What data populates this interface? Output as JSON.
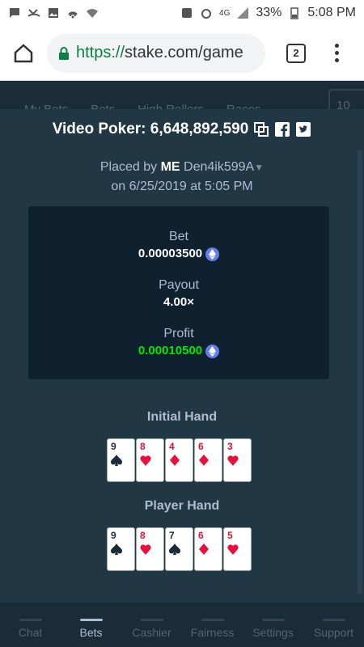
{
  "statusbar": {
    "battery": "33%",
    "time": "5:08 PM",
    "network": "4G"
  },
  "browser": {
    "url_scheme": "https://",
    "url_rest": "stake.com/game",
    "tab_count": "2"
  },
  "bg_tabs": [
    "My Bets",
    "Bets",
    "High Rollers",
    "Races"
  ],
  "bg_select": "10",
  "modal": {
    "title": "Video Poker: 6,648,892,590",
    "placed_prefix": "Placed by",
    "placed_me": "ME",
    "username": "Den4ik599A",
    "date_line": "on 6/25/2019 at 5:05 PM"
  },
  "stats": {
    "bet_label": "Bet",
    "bet_value": "0.00003500",
    "payout_label": "Payout",
    "payout_value": "4.00×",
    "profit_label": "Profit",
    "profit_value": "0.00010500"
  },
  "initial_hand": {
    "label": "Initial Hand",
    "cards": [
      {
        "rank": "9",
        "suit": "spade"
      },
      {
        "rank": "8",
        "suit": "heart"
      },
      {
        "rank": "4",
        "suit": "diamond"
      },
      {
        "rank": "6",
        "suit": "diamond"
      },
      {
        "rank": "3",
        "suit": "heart"
      }
    ]
  },
  "player_hand": {
    "label": "Player Hand",
    "cards": [
      {
        "rank": "9",
        "suit": "spade"
      },
      {
        "rank": "8",
        "suit": "heart"
      },
      {
        "rank": "7",
        "suit": "spade"
      },
      {
        "rank": "6",
        "suit": "diamond"
      },
      {
        "rank": "5",
        "suit": "heart"
      }
    ]
  },
  "bottom_nav": [
    {
      "label": "Chat",
      "icon": "chat-icon"
    },
    {
      "label": "Bets",
      "icon": "bets-icon"
    },
    {
      "label": "Cashier",
      "icon": "cashier-icon"
    },
    {
      "label": "Fairness",
      "icon": "fairness-icon"
    },
    {
      "label": "Settings",
      "icon": "settings-icon"
    },
    {
      "label": "Support",
      "icon": "support-icon"
    }
  ],
  "colors": {
    "profit": "#00e701",
    "modal_bg": "#213743",
    "stat_bg": "#0f212e",
    "eth": "#627eea"
  }
}
